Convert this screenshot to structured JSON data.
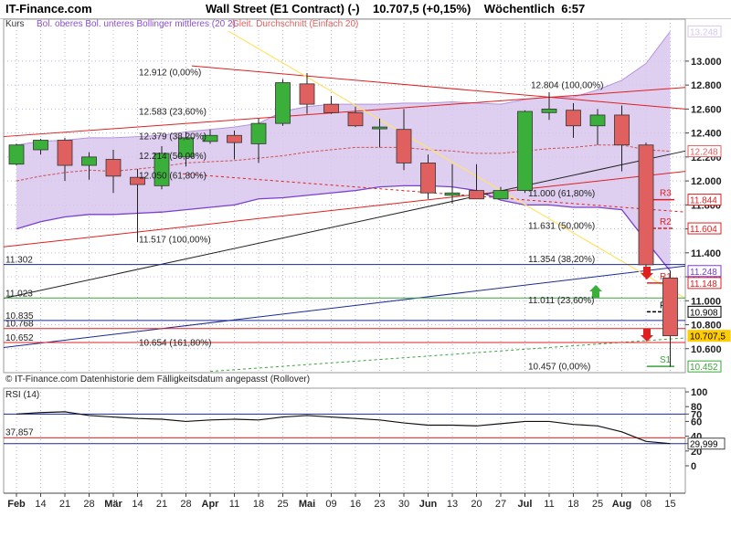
{
  "header": {
    "logo": "IT-Finance.com",
    "title": "Wall Street (E1 Contract) (-)    10.707,5 (+0,15%)    Wöchentlich  6:57"
  },
  "colors": {
    "up": "#3ab03a",
    "down": "#e06060",
    "band_fill": "#d8c6ec",
    "band_line": "#7a3fcf",
    "red_line": "#e02020",
    "blue_line": "#1a2a9a",
    "yellow_line": "#ffe36a",
    "green_line": "#39a539",
    "grid": "#b8b8d8"
  },
  "legend": {
    "kurs": "Kurs",
    "bollinger": "Bol. oberes Bol. unteres Bollinger mittleres (20 2)",
    "gleit": "Gleit. Durchschnitt (Einfach 20)"
  },
  "footer_note": "© IT-Finance.com  Datenhistorie dem Fälligkeitsdatum angepasst (Rollover)",
  "chart_data": [
    {
      "type": "candlestick",
      "title": "Wall Street (E1 Contract) (-)",
      "ylim": [
        10400,
        13350
      ],
      "y_ticks": [
        "13.000",
        "12.800",
        "12.600",
        "12.400",
        "12.200",
        "12.000",
        "11.800",
        "11.600",
        "11.400",
        "11.200",
        "11.000",
        "10.800",
        "10.600"
      ],
      "x_labels": [
        "Feb",
        "14",
        "21",
        "28",
        "Mär",
        "14",
        "21",
        "28",
        "Apr",
        "11",
        "18",
        "25",
        "Mai",
        "09",
        "16",
        "23",
        "30",
        "Jun",
        "13",
        "20",
        "27",
        "Jul",
        "11",
        "18",
        "25",
        "Aug",
        "08",
        "15"
      ],
      "candles": [
        {
          "date": "2011-01-31",
          "open": 12140,
          "high": 12310,
          "low": 12130,
          "close": 12300
        },
        {
          "date": "2011-02-07",
          "open": 12260,
          "high": 12350,
          "low": 12220,
          "close": 12340
        },
        {
          "date": "2011-02-14",
          "open": 12340,
          "high": 12360,
          "low": 12000,
          "close": 12130
        },
        {
          "date": "2011-02-21",
          "open": 12130,
          "high": 12240,
          "low": 12010,
          "close": 12200
        },
        {
          "date": "2011-02-28",
          "open": 12180,
          "high": 12260,
          "low": 11900,
          "close": 12040
        },
        {
          "date": "2011-03-07",
          "open": 12030,
          "high": 12100,
          "low": 11490,
          "close": 11970
        },
        {
          "date": "2011-03-14",
          "open": 11960,
          "high": 12290,
          "low": 11930,
          "close": 12230
        },
        {
          "date": "2011-03-21",
          "open": 12200,
          "high": 12410,
          "low": 12120,
          "close": 12360
        },
        {
          "date": "2011-03-28",
          "open": 12330,
          "high": 12430,
          "low": 12310,
          "close": 12380
        },
        {
          "date": "2011-04-04",
          "open": 12380,
          "high": 12420,
          "low": 12180,
          "close": 12320
        },
        {
          "date": "2011-04-11",
          "open": 12310,
          "high": 12520,
          "low": 12150,
          "close": 12480
        },
        {
          "date": "2011-04-18",
          "open": 12480,
          "high": 12850,
          "low": 12460,
          "close": 12820
        },
        {
          "date": "2011-04-25",
          "open": 12810,
          "high": 12900,
          "low": 12560,
          "close": 12640
        },
        {
          "date": "2011-05-02",
          "open": 12640,
          "high": 12710,
          "low": 12560,
          "close": 12570
        },
        {
          "date": "2011-05-09",
          "open": 12570,
          "high": 12620,
          "low": 12450,
          "close": 12460
        },
        {
          "date": "2011-05-16",
          "open": 12450,
          "high": 12520,
          "low": 12280,
          "close": 12450
        },
        {
          "date": "2011-05-23",
          "open": 12430,
          "high": 12600,
          "low": 12090,
          "close": 12150
        },
        {
          "date": "2011-05-30",
          "open": 12150,
          "high": 12220,
          "low": 11850,
          "close": 11900
        },
        {
          "date": "2011-06-06",
          "open": 11880,
          "high": 12140,
          "low": 11810,
          "close": 11900
        },
        {
          "date": "2011-06-13",
          "open": 11920,
          "high": 12140,
          "low": 11850,
          "close": 11850
        },
        {
          "date": "2011-06-20",
          "open": 11850,
          "high": 11950,
          "low": 11850,
          "close": 11920
        },
        {
          "date": "2011-06-27",
          "open": 11920,
          "high": 12590,
          "low": 11900,
          "close": 12580
        },
        {
          "date": "2011-07-04",
          "open": 12570,
          "high": 12740,
          "low": 12510,
          "close": 12600
        },
        {
          "date": "2011-07-11",
          "open": 12590,
          "high": 12650,
          "low": 12360,
          "close": 12460
        },
        {
          "date": "2011-07-18",
          "open": 12460,
          "high": 12600,
          "low": 12300,
          "close": 12550
        },
        {
          "date": "2011-07-25",
          "open": 12550,
          "high": 12630,
          "low": 12080,
          "close": 12300
        },
        {
          "date": "2011-08-01",
          "open": 12300,
          "high": 12320,
          "low": 11180,
          "close": 11300
        },
        {
          "date": "2011-08-08",
          "open": 11190,
          "high": 11250,
          "low": 10450,
          "close": 10707.5
        }
      ],
      "fibonacci": {
        "labels": [
          {
            "label": "12.912 (0,00%)",
            "value": 12912
          },
          {
            "label": "12.583 (23,60%)",
            "value": 12583
          },
          {
            "label": "12.379 (38,20%)",
            "value": 12379
          },
          {
            "label": "12.214 (50,00%)",
            "value": 12214
          },
          {
            "label": "12.050 (61,80%)",
            "value": 12050
          },
          {
            "label": "11.517 (100,00%)",
            "value": 11517
          },
          {
            "label": "10.654 (161,80%)",
            "value": 10654
          },
          {
            "label": "12.804 (100,00%)",
            "value": 12804
          },
          {
            "label": "11.000 (61,80%)",
            "value": 11900
          },
          {
            "label": "11.631 (50,00%)",
            "value": 11631
          },
          {
            "label": "11.354 (38,20%)",
            "value": 11354
          },
          {
            "label": "11.011 (23,60%)",
            "value": 11011
          },
          {
            "label": "10.457 (0,00%)",
            "value": 10457
          }
        ]
      },
      "pivots": [
        {
          "name": "R3",
          "value": 11844
        },
        {
          "name": "R2",
          "value": 11604
        },
        {
          "name": "R1",
          "value": 11148
        },
        {
          "name": "Piv",
          "value": 10908
        },
        {
          "name": "S1",
          "value": 10452
        }
      ],
      "right_labels": [
        {
          "text": "13.248",
          "value": 13248,
          "color": "#d8c6ec"
        },
        {
          "text": "12.248",
          "value": 12248,
          "color": "#e06060"
        },
        {
          "text": "11.844",
          "value": 11844,
          "color": "#e02020"
        },
        {
          "text": "11.604",
          "value": 11604,
          "color": "#e02020"
        },
        {
          "text": "11.248",
          "value": 11248,
          "color": "#7a3fcf"
        },
        {
          "text": "11.148",
          "value": 11148,
          "color": "#e02020"
        },
        {
          "text": "10.908",
          "value": 10908,
          "color": "#000000"
        },
        {
          "text": "10.707,5",
          "value": 10707.5,
          "color": "#ffcc00"
        },
        {
          "text": "10.452",
          "value": 10452,
          "color": "#39a539"
        }
      ],
      "left_labels": [
        {
          "text": "11.302",
          "value": 11302
        },
        {
          "text": "11.023",
          "value": 11023
        },
        {
          "text": "10.835",
          "value": 10835
        },
        {
          "text": "10.768",
          "value": 10768
        },
        {
          "text": "10.652",
          "value": 10652
        }
      ],
      "bollinger_upper": [
        12300,
        12330,
        12340,
        12360,
        12360,
        12370,
        12380,
        12410,
        12430,
        12450,
        12480,
        12580,
        12620,
        12640,
        12640,
        12640,
        12650,
        12650,
        12660,
        12650,
        12640,
        12680,
        12700,
        12700,
        12760,
        12840,
        12980,
        13248
      ],
      "bollinger_lower": [
        11600,
        11660,
        11700,
        11720,
        11720,
        11730,
        11740,
        11760,
        11780,
        11800,
        11850,
        11860,
        11880,
        11900,
        11920,
        11950,
        11960,
        11960,
        11950,
        11920,
        11840,
        11800,
        11800,
        11780,
        11780,
        11760,
        11500,
        11248
      ],
      "moving_average": [
        12000,
        12040,
        12070,
        12090,
        12080,
        12100,
        12120,
        12150,
        12160,
        12170,
        12190,
        12210,
        12240,
        12260,
        12280,
        12280,
        12280,
        12260,
        12250,
        12230,
        12230,
        12250,
        12270,
        12280,
        12300,
        12300,
        12260,
        12248
      ]
    },
    {
      "type": "line",
      "title": "RSI (14)",
      "ylim": [
        0,
        105
      ],
      "y_ticks": [
        "100",
        "80",
        "70",
        "60",
        "40",
        "30",
        "20",
        "0"
      ],
      "levels": [
        {
          "text": "37,857",
          "value": 37.857
        }
      ],
      "current": {
        "text": "29,999",
        "value": 29.999
      },
      "values": [
        70,
        72,
        73,
        68,
        66,
        64,
        63,
        60,
        62,
        63,
        62,
        66,
        68,
        66,
        64,
        62,
        58,
        55,
        55,
        54,
        57,
        60,
        60,
        56,
        54,
        46,
        33,
        30
      ]
    }
  ]
}
